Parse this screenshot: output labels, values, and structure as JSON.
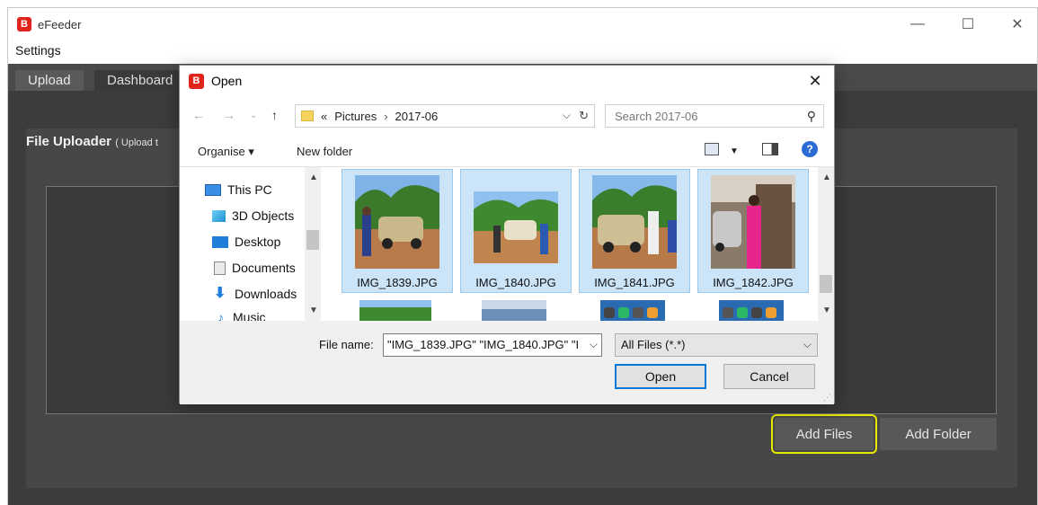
{
  "app": {
    "title": "eFeeder",
    "logo_letter": "B"
  },
  "window_controls": {
    "minimize": "—",
    "maximize": "☐",
    "close": "✕"
  },
  "menu": {
    "settings": "Settings"
  },
  "tabs": [
    {
      "label": "Upload"
    },
    {
      "label": "Dashboard"
    }
  ],
  "panel": {
    "title": "File Uploader",
    "subtitle": "( Upload t"
  },
  "buttons": {
    "add_files": "Add Files",
    "add_folder": "Add Folder"
  },
  "dialog": {
    "title": "Open",
    "logo_letter": "B",
    "close": "✕",
    "breadcrumb": {
      "prefix": "«",
      "parts": [
        "Pictures",
        "2017-06"
      ]
    },
    "search_placeholder": "Search 2017-06",
    "organise": "Organise ▾",
    "new_folder": "New folder",
    "help": "?",
    "nav_items": [
      {
        "label": "This PC"
      },
      {
        "label": "3D Objects"
      },
      {
        "label": "Desktop"
      },
      {
        "label": "Documents"
      },
      {
        "label": "Downloads"
      },
      {
        "label": "Music"
      }
    ],
    "files": [
      {
        "name": "IMG_1839.JPG",
        "selected": true
      },
      {
        "name": "IMG_1840.JPG",
        "selected": true
      },
      {
        "name": "IMG_1841.JPG",
        "selected": true
      },
      {
        "name": "IMG_1842.JPG",
        "selected": true
      }
    ],
    "file_name_label": "File name:",
    "file_name_value": "\"IMG_1839.JPG\" \"IMG_1840.JPG\" \"I",
    "file_type": "All Files (*.*)",
    "open_label": "Open",
    "cancel_label": "Cancel"
  },
  "colors": {
    "accent": "#0078d7",
    "highlight": "#e8e800",
    "selection": "#cce4f7",
    "brand": "#e0241b"
  }
}
